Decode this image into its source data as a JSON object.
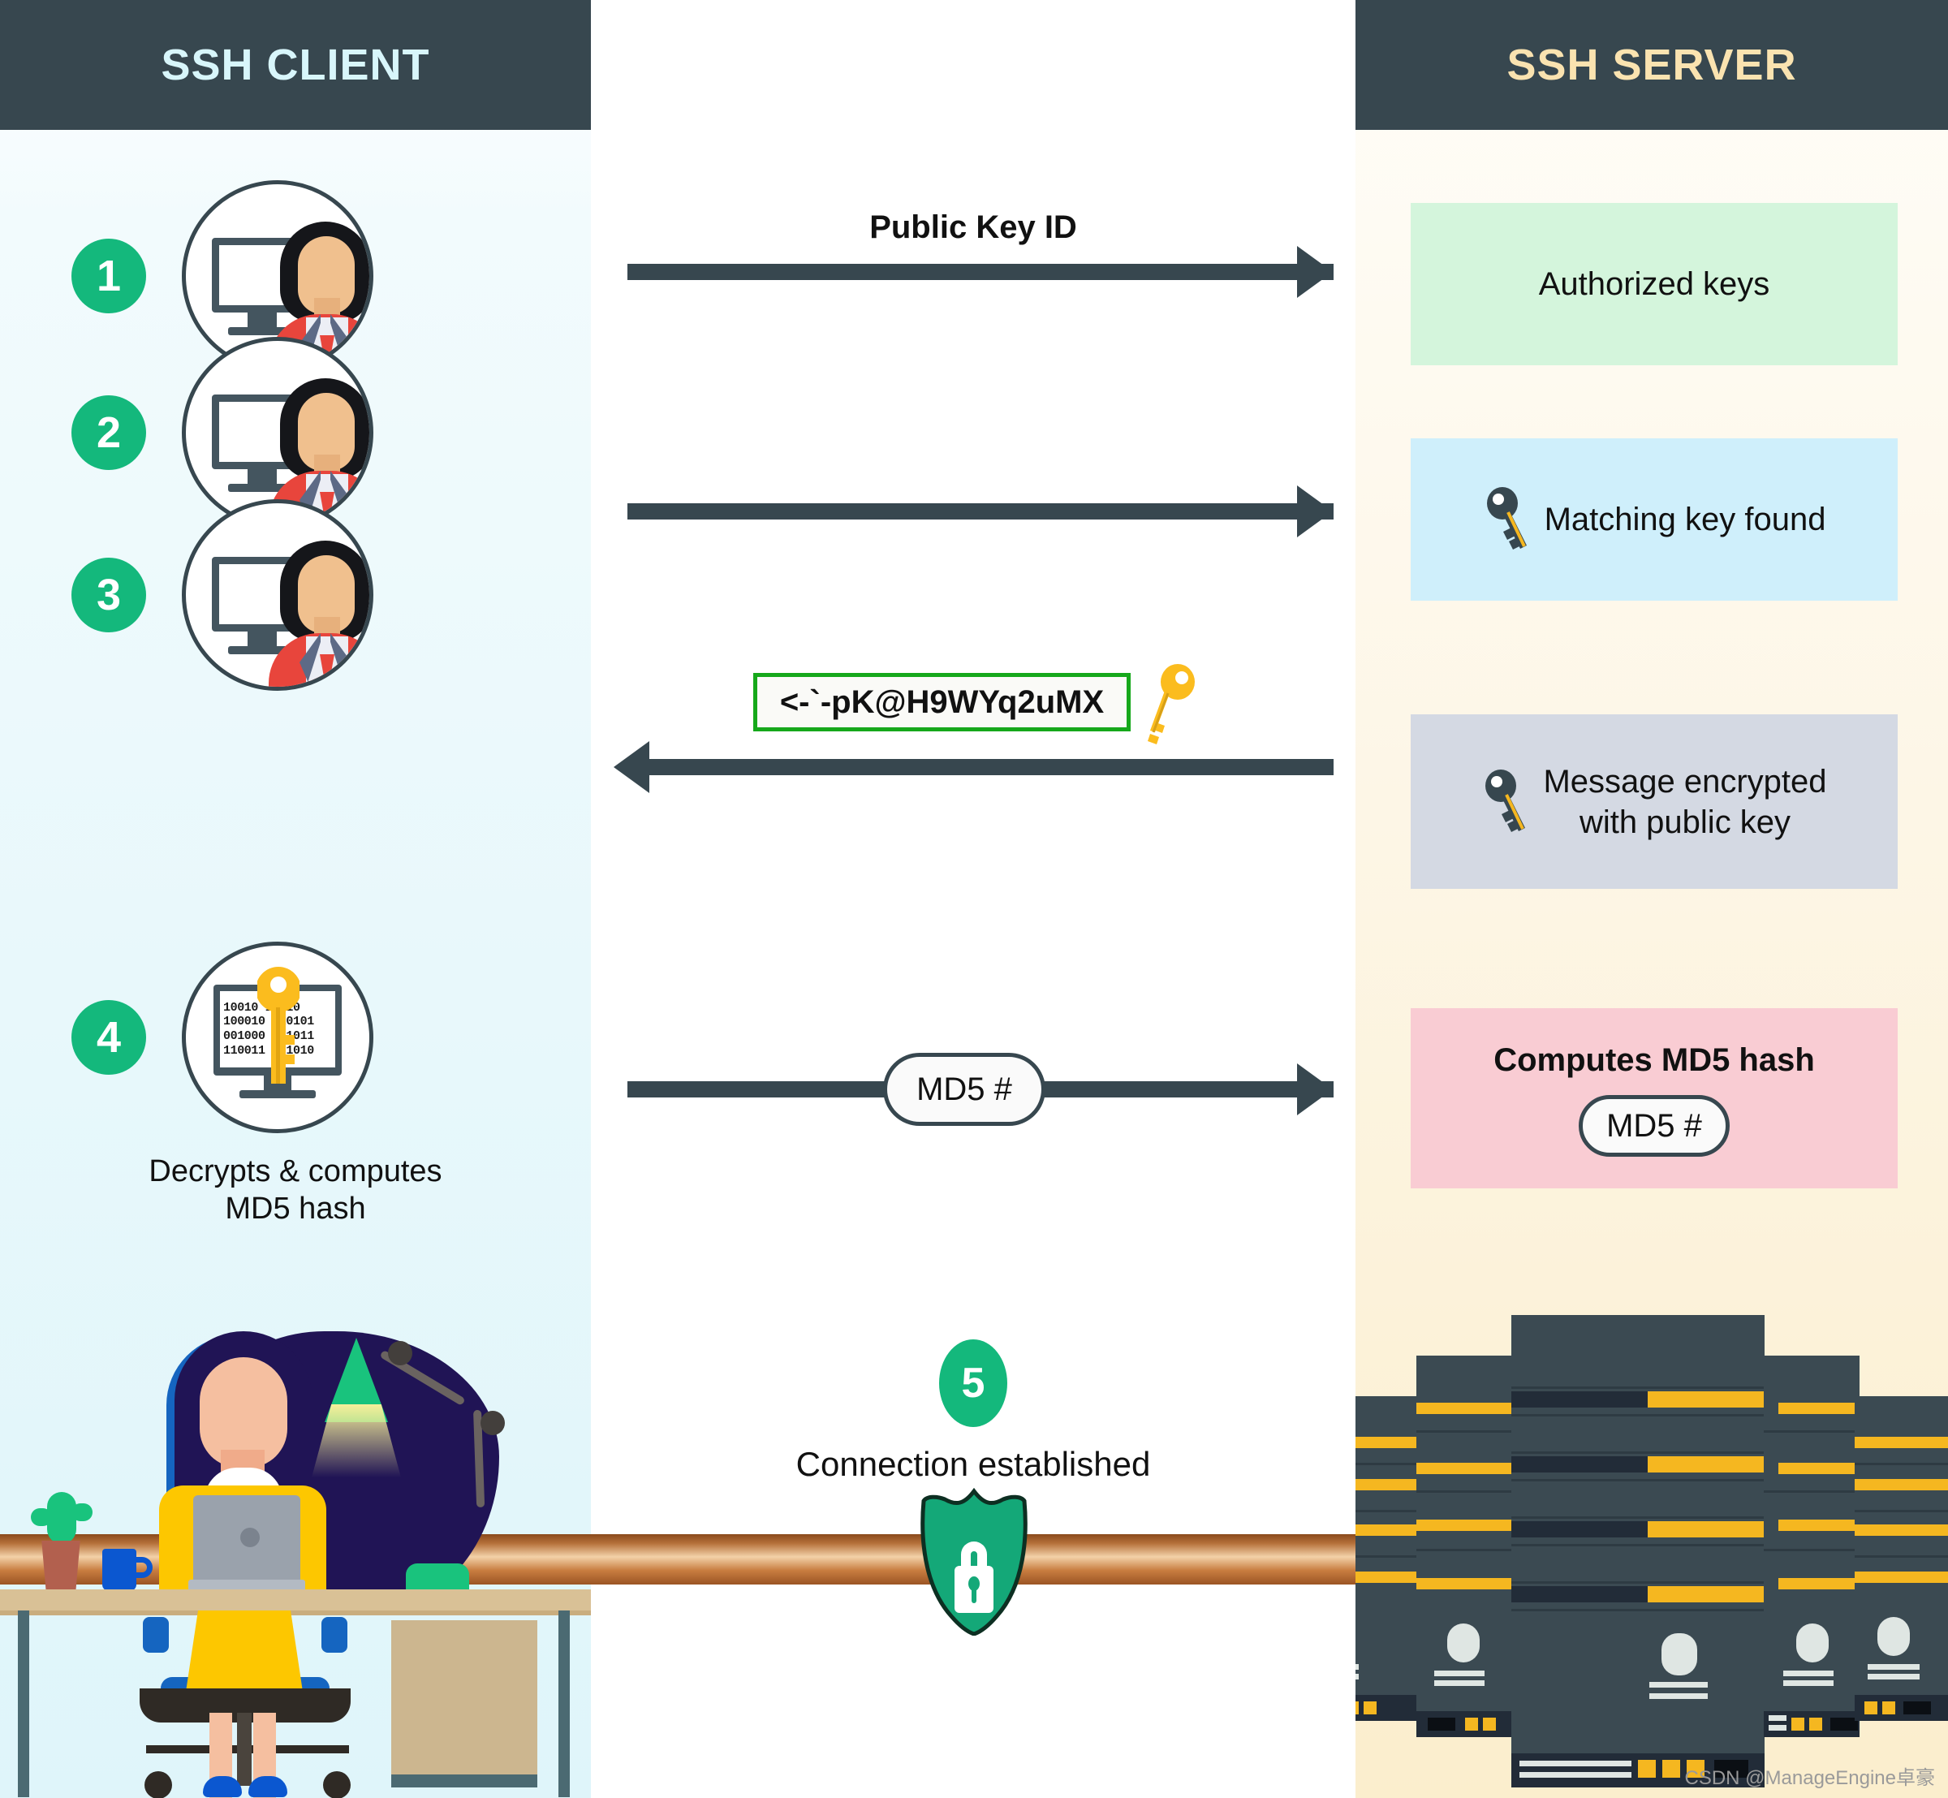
{
  "headers": {
    "client": "SSH CLIENT",
    "server": "SSH SERVER"
  },
  "steps": [
    {
      "number": "1",
      "icon": "user-computer-icon"
    },
    {
      "number": "2",
      "icon": "user-computer-icon"
    },
    {
      "number": "3",
      "icon": "user-computer-icon"
    },
    {
      "number": "4",
      "icon": "decrypt-monitor-key-icon",
      "caption": "Decrypts & computes\nMD5 hash"
    },
    {
      "number": "5",
      "icon": "shield-lock-icon",
      "caption": "Connection established"
    }
  ],
  "step4": {
    "caption_line1": "Decrypts & computes",
    "caption_line2": "MD5 hash",
    "binary_rows": [
      "10010 10010",
      "100010 010101",
      "001000 011011",
      "110011 001010"
    ]
  },
  "arrows": [
    {
      "id": "arrow-public-key-id",
      "label": "Public Key ID",
      "direction": "right"
    },
    {
      "id": "arrow-step2",
      "label": "",
      "direction": "right"
    },
    {
      "id": "arrow-encrypted-message",
      "label": "",
      "direction": "left"
    },
    {
      "id": "arrow-md5",
      "label": "MD5 #",
      "direction": "right"
    }
  ],
  "encrypted_message": {
    "text": "<-`-pK@H9WYq2uMX",
    "border_color": "#16a81b",
    "key_icon": "yellow-key-icon"
  },
  "md5_pill": {
    "label": "MD5 #"
  },
  "server_boxes": [
    {
      "id": "authorized-keys-box",
      "text": "Authorized keys",
      "bg": "#d4f5dc",
      "icon": null
    },
    {
      "id": "matching-key-box",
      "text": "Matching key found",
      "bg": "#cfeffb",
      "icon": "dark-key-icon"
    },
    {
      "id": "message-encrypted-box",
      "text_line1": "Message encrypted",
      "text_line2": "with public key",
      "bg": "#d4d9e3",
      "icon": "dark-key-icon"
    },
    {
      "id": "computes-md5-box",
      "title": "Computes MD5 hash",
      "pill": "MD5 #",
      "bg": "#f9ccd3",
      "icon": null
    }
  ],
  "connection": {
    "step_number": "5",
    "label": "Connection established",
    "shield_icon": "shield-lock-icon",
    "shield_color": "#14a878"
  },
  "watermark": "CSDN @ManageEngine卓豪",
  "colors": {
    "header_bg": "#37474f",
    "client_title": "#d8f6fb",
    "server_title": "#fae3b0",
    "step_badge": "#14b87c",
    "arrow": "#37474f",
    "client_panel": "#e8f8fb",
    "server_panel": "#fdf6e6",
    "pipe": "#c87d40",
    "rack_dark": "#3b4a52",
    "rack_accent": "#f5b720"
  }
}
